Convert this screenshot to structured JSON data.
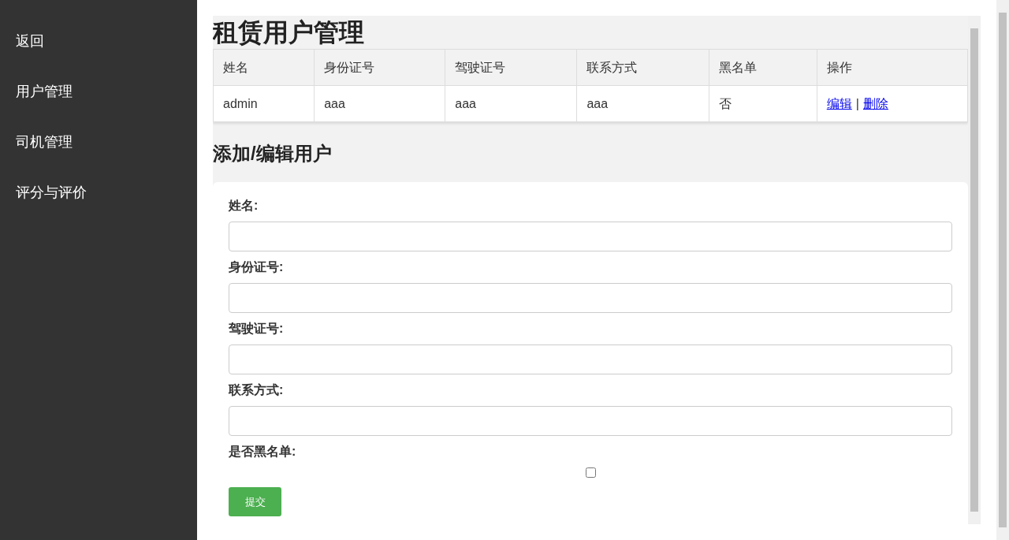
{
  "sidebar": {
    "items": [
      {
        "label": "返回"
      },
      {
        "label": "用户管理"
      },
      {
        "label": "司机管理"
      },
      {
        "label": "评分与评价"
      }
    ]
  },
  "page_title": "租赁用户管理",
  "table": {
    "columns": [
      "姓名",
      "身份证号",
      "驾驶证号",
      "联系方式",
      "黑名单",
      "操作"
    ],
    "rows": [
      {
        "cells": [
          "admin",
          "aaa",
          "aaa",
          "aaa",
          "否"
        ],
        "actions": [
          "编辑",
          "删除"
        ],
        "separator": "|"
      }
    ]
  },
  "form": {
    "title": "添加/编辑用户",
    "fields": [
      {
        "kind": "text",
        "label": "姓名:"
      },
      {
        "kind": "text",
        "label": "身份证号:"
      },
      {
        "kind": "text",
        "label": "驾驶证号:"
      },
      {
        "kind": "text",
        "label": "联系方式:"
      },
      {
        "kind": "checkbox",
        "label": "是否黑名单:",
        "checked": false
      }
    ],
    "submit": "提交"
  }
}
